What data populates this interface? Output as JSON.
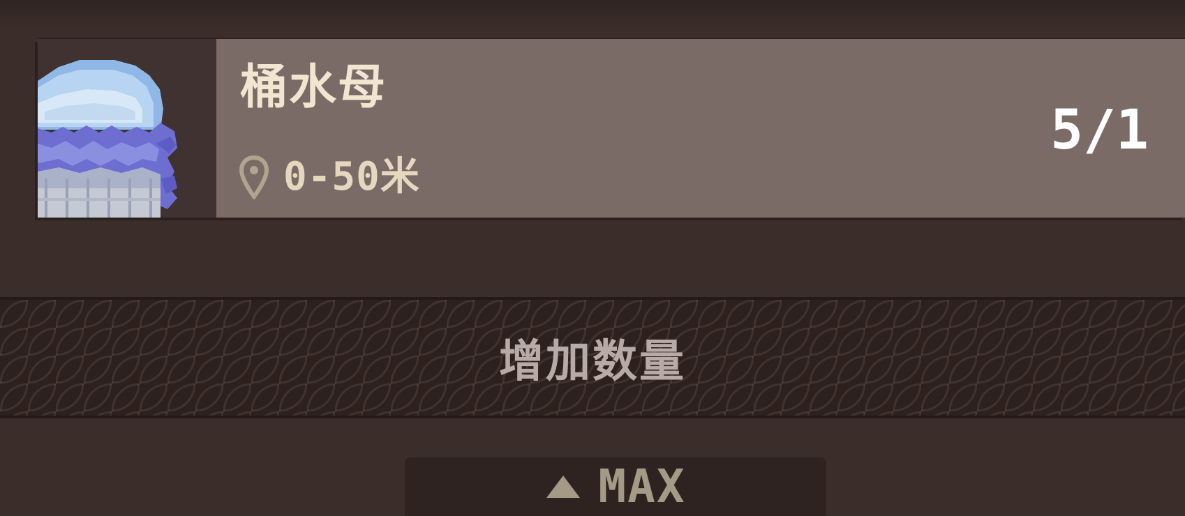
{
  "creature": {
    "name": "桶水母",
    "depth_range": "0-50米",
    "count": "5/1",
    "icons": {
      "portrait": "jellyfish-icon",
      "location": "location-pin-icon"
    }
  },
  "increase_button": {
    "label": "增加数量"
  },
  "max_button": {
    "label": "MAX",
    "icon": "triangle-up-icon"
  },
  "colors": {
    "background": "#3b2d2a",
    "card": "#7a6b67",
    "name_text": "#f2e6d0",
    "count_text": "#ffffff",
    "button_text": "#b8aba7",
    "max_text": "#a59a86"
  }
}
